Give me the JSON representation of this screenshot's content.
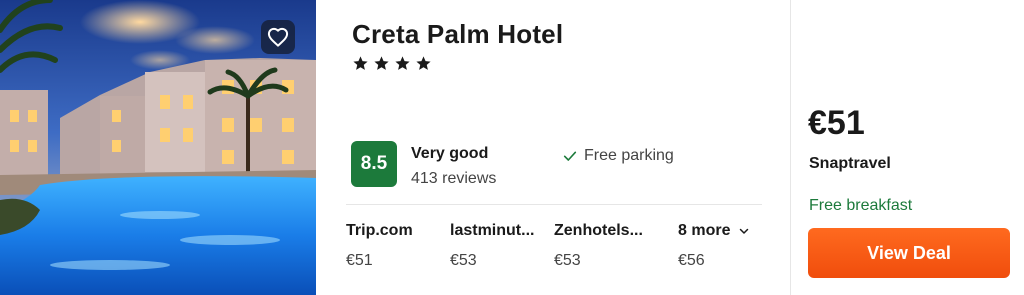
{
  "hotel": {
    "name": "Creta Palm Hotel",
    "star_count": 4
  },
  "rating": {
    "score": "8.5",
    "label": "Very good",
    "reviews": "413 reviews"
  },
  "amenity": {
    "label": "Free parking",
    "icon": "check-icon"
  },
  "offers": [
    {
      "provider": "Trip.com",
      "price": "€51"
    },
    {
      "provider": "lastminut...",
      "price": "€53"
    },
    {
      "provider": "Zenhotels...",
      "price": "€53"
    }
  ],
  "more_offers": {
    "label": "8 more",
    "price": "€56"
  },
  "best_deal": {
    "price": "€51",
    "provider": "Snaptravel",
    "perk": "Free breakfast",
    "button_label": "View Deal"
  },
  "colors": {
    "rating_badge": "#1c7a3b",
    "deal_button": "#f04d0c",
    "perk_text": "#1c7a3b"
  },
  "icons": {
    "favorite": "heart-icon",
    "star": "star-icon",
    "chevron": "chevron-down-icon"
  }
}
